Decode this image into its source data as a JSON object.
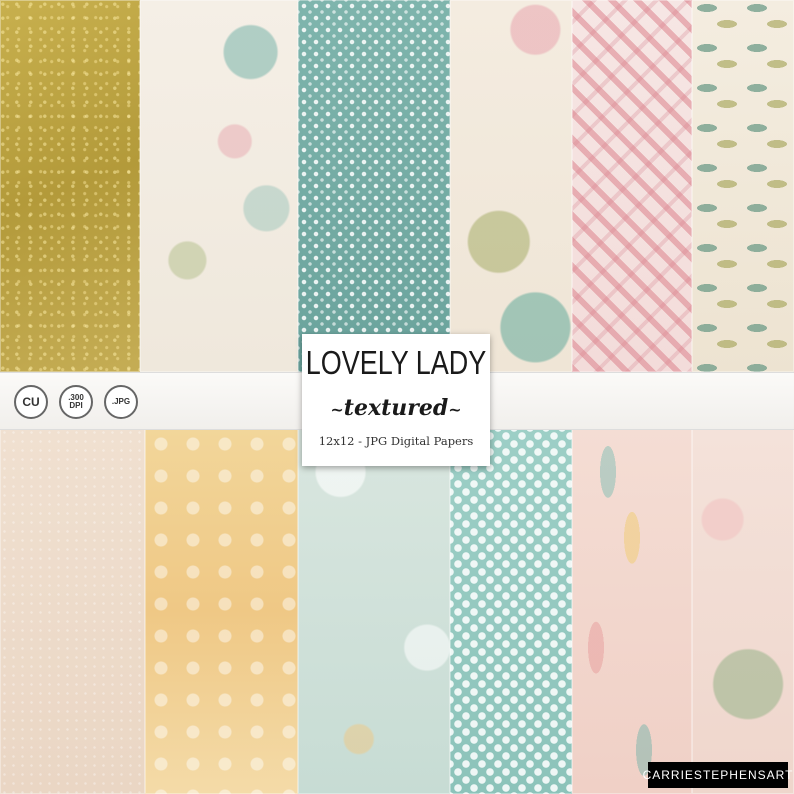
{
  "product": {
    "title": "LOVELY LADY",
    "subtitle": "textured",
    "subtitle_decoration_left": "~",
    "subtitle_decoration_right": "~",
    "description": "12x12 - JPG Digital Papers"
  },
  "badges": {
    "cu": "CU",
    "dpi_top": ".300",
    "dpi_bottom": "DPI",
    "jpg": ".JPG"
  },
  "brand": "CARRIESTEPHENSART",
  "papers": {
    "top": [
      "gold-floral-paper",
      "cream-floral-paper",
      "teal-baby-breath-paper",
      "cream-leaf-paper",
      "pink-plaid-paper",
      "leaf-pattern-paper"
    ],
    "bottom": [
      "beige-speckle-paper",
      "yellow-floral-paper",
      "pale-teal-floral-paper",
      "teal-polka-dot-paper",
      "pink-feather-paper",
      "pink-floral-paper"
    ]
  },
  "colors": {
    "gold": "#c2a84a",
    "teal": "#7fb5ad",
    "pink": "#f0d0c6",
    "cream": "#f4ede0",
    "badge_border": "#666666",
    "brand_bg": "#000000"
  }
}
